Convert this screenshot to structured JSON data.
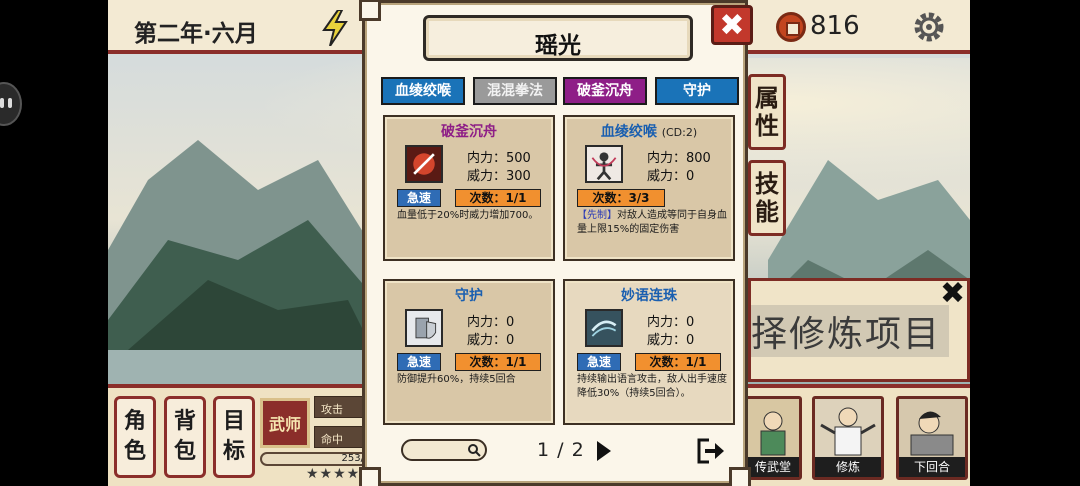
{
  "topbar": {
    "date": "第二年·六月",
    "coins": "816"
  },
  "sidepanel": {
    "attributes_tab": "属性",
    "skills_tab": "技能"
  },
  "training": {
    "title": "择修炼项目"
  },
  "bottom": {
    "role": "角色",
    "bag": "背包",
    "goal": "目标",
    "class_name": "武师",
    "attack_label": "攻击",
    "hit_label": "命中",
    "xp_text": "253/",
    "stars": "★★★★",
    "scenes": [
      {
        "label": "传武堂"
      },
      {
        "label": "修炼"
      },
      {
        "label": "下回合"
      }
    ]
  },
  "modal": {
    "title": "瑶光",
    "tabs": [
      "血绫绞喉",
      "混混拳法",
      "破釜沉舟",
      "守护"
    ],
    "cards": [
      {
        "name": "破釜沉舟",
        "name_color": "#8e1e87",
        "cd": "",
        "stat_a": "内力：500",
        "stat_b": "威力：300",
        "fast": "急速",
        "count": "次数：1/1",
        "tag": "",
        "desc": "血量低于20%时威力增加700。",
        "icon": "sword-slash-icon"
      },
      {
        "name": "血绫绞喉",
        "name_color": "#1a5fb0",
        "cd": "(CD:2)",
        "stat_a": "内力：800",
        "stat_b": "威力：0",
        "fast": "",
        "count": "次数：3/3",
        "tag": "【先制】",
        "desc": "对敌人造成等同于自身血量上限15%的固定伤害",
        "icon": "strangle-figure-icon"
      },
      {
        "name": "守护",
        "name_color": "#1a5fb0",
        "cd": "",
        "stat_a": "内力：0",
        "stat_b": "威力：0",
        "fast": "急速",
        "count": "次数：1/1",
        "tag": "",
        "desc": "防御提升60%，持续5回合",
        "icon": "armor-shield-icon"
      },
      {
        "name": "妙语连珠",
        "name_color": "#1a5fb0",
        "cd": "",
        "stat_a": "内力：0",
        "stat_b": "威力：0",
        "fast": "急速",
        "count": "次数：1/1",
        "tag": "",
        "desc": "持续输出语言攻击，敌人出手速度降低30%（持续5回合）。",
        "icon": "speech-wave-icon"
      }
    ],
    "pager": "1 / 2"
  }
}
